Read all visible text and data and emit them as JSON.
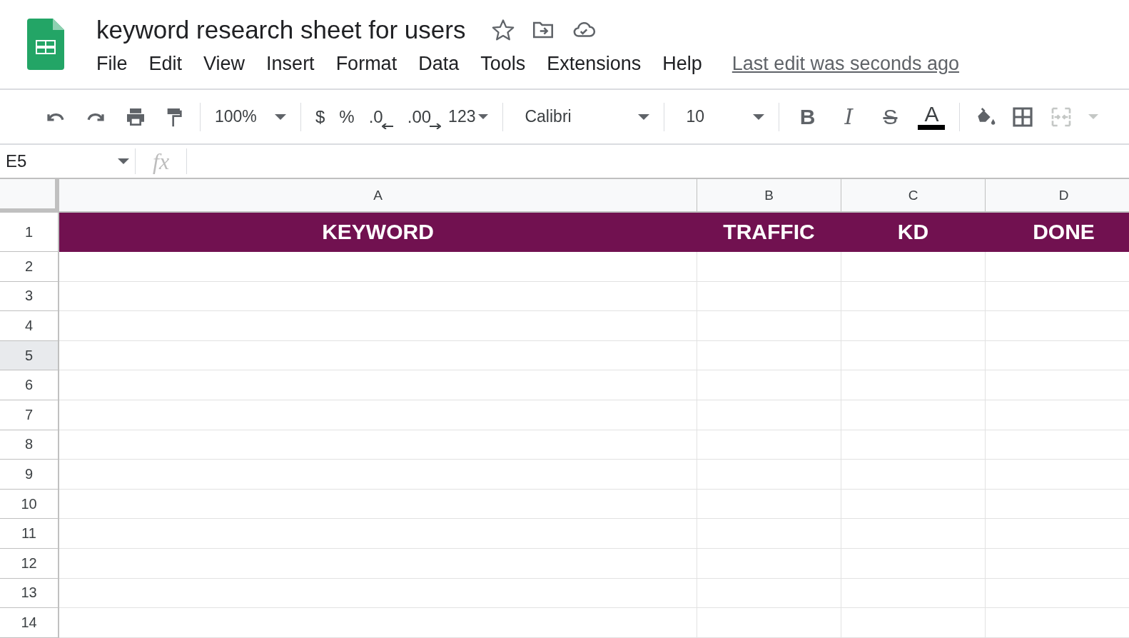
{
  "document": {
    "title": "keyword research sheet for users",
    "last_edit": "Last edit was seconds ago"
  },
  "menu": [
    "File",
    "Edit",
    "View",
    "Insert",
    "Format",
    "Data",
    "Tools",
    "Extensions",
    "Help"
  ],
  "toolbar": {
    "zoom": "100%",
    "format_buttons": [
      "$",
      "%",
      ".0",
      ".00"
    ],
    "number_format": "123",
    "font": "Calibri",
    "font_size": "10",
    "text_style_buttons": [
      "B",
      "I",
      "S",
      "A"
    ]
  },
  "formula_bar": {
    "name_box": "E5",
    "fx": "fx"
  },
  "columns": [
    {
      "label": "A",
      "selected": false
    },
    {
      "label": "B",
      "selected": false
    },
    {
      "label": "C",
      "selected": false
    },
    {
      "label": "D",
      "selected": false
    }
  ],
  "header_row": [
    "KEYWORD",
    "TRAFFIC",
    "KD",
    "DONE"
  ],
  "rows": [
    {
      "number": "1",
      "selected": false
    },
    {
      "number": "2",
      "selected": false
    },
    {
      "number": "3",
      "selected": false
    },
    {
      "number": "4",
      "selected": false
    },
    {
      "number": "5",
      "selected": true
    },
    {
      "number": "6",
      "selected": false
    },
    {
      "number": "7",
      "selected": false
    },
    {
      "number": "8",
      "selected": false
    },
    {
      "number": "9",
      "selected": false
    },
    {
      "number": "10",
      "selected": false
    },
    {
      "number": "11",
      "selected": false
    },
    {
      "number": "12",
      "selected": false
    },
    {
      "number": "13",
      "selected": false
    },
    {
      "number": "14",
      "selected": false
    }
  ]
}
